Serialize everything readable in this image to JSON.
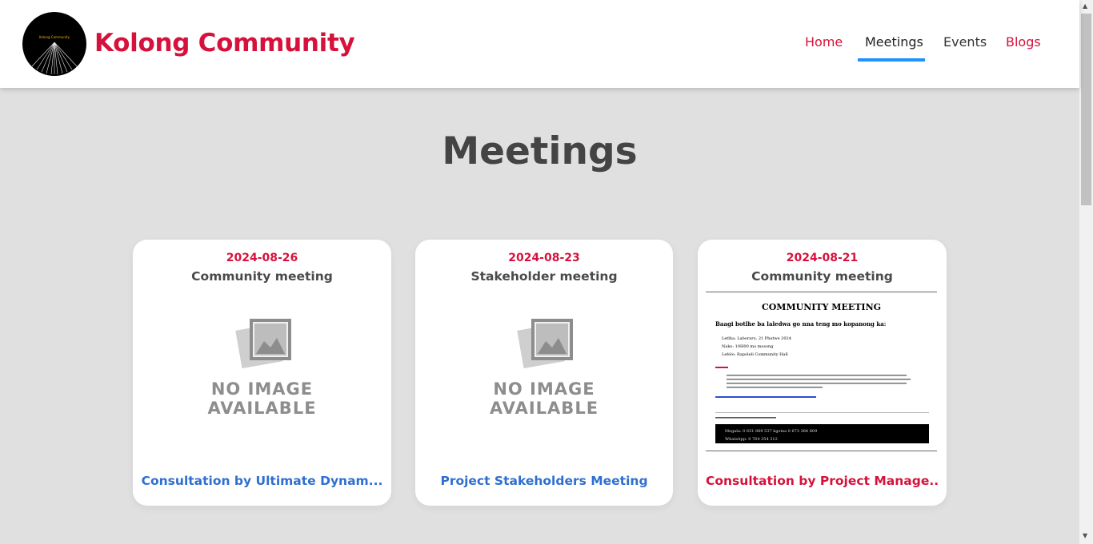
{
  "header": {
    "logo_text": "Kolong Community",
    "brand": "Kolong Community",
    "nav": [
      {
        "label": "Home",
        "color": "#d6123c"
      },
      {
        "label": "Meetings",
        "color": "#222222",
        "active": true
      },
      {
        "label": "Events",
        "color": "#333333"
      },
      {
        "label": "Blogs",
        "color": "#d6123c"
      }
    ],
    "active_color": "#1e90ff"
  },
  "main": {
    "title": "Meetings",
    "cards": [
      {
        "date": "2024-08-26",
        "title": "Community meeting",
        "image": "NO IMAGE AVAILABLE",
        "link": "Consultation by Ultimate Dynam...",
        "link_color": "#2e6fd1"
      },
      {
        "date": "2024-08-23",
        "title": "Stakeholder meeting",
        "image": "NO IMAGE AVAILABLE",
        "link": "Project Stakeholders Meeting",
        "link_color": "#2e6fd1"
      },
      {
        "date": "2024-08-21",
        "title": "Community meeting",
        "link": "Consultation by Project Manage...",
        "link_color": "#d6123c",
        "document": {
          "heading": "COMMUNITY MEETING",
          "sub": "Baagi botlhe ba laledwa go nna teng mo kopanong ka:",
          "items": [
            "Letlha: Laboraro, 21 Phatwe 2024",
            "Nako: 10H00 mo mosong",
            "Lefelo: Rapoleli Community Hall"
          ],
          "contact": [
            "Megala: 0 651 869 537 kgotsa 0 673 384 809",
            "WhatsApp: 0 764 354 312"
          ]
        }
      }
    ]
  },
  "image_labels": {
    "line1": "NO IMAGE",
    "line2": "AVAILABLE"
  }
}
